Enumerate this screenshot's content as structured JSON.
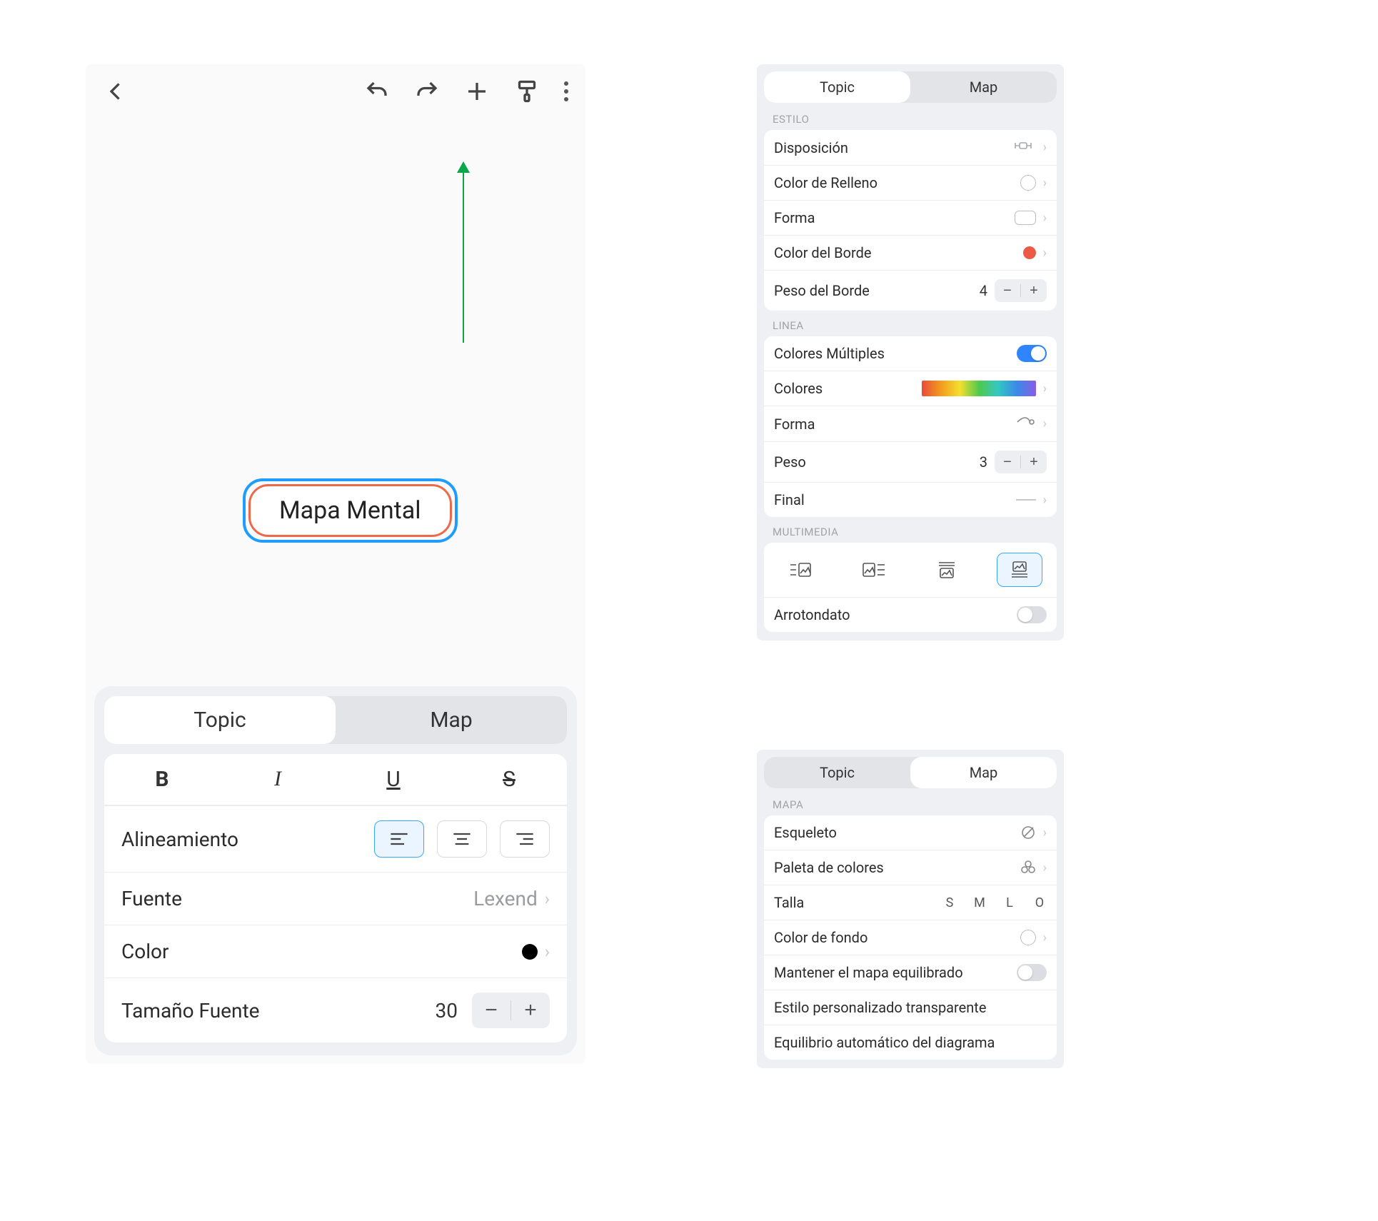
{
  "left_panel": {
    "canvas_node_text": "Mapa Mental",
    "tabs": {
      "topic": "Topic",
      "map": "Map"
    },
    "rows": {
      "alignment_label": "Alineamiento",
      "font_label": "Fuente",
      "font_value": "Lexend",
      "color_label": "Color",
      "font_size_label": "Tamaño Fuente",
      "font_size_value": "30"
    }
  },
  "right_top": {
    "tabs": {
      "topic": "Topic",
      "map": "Map"
    },
    "sections": {
      "estilo": "ESTILO",
      "linea": "LINEA",
      "multimedia": "MULTIMEDIA"
    },
    "estilo": {
      "disposicion": "Disposición",
      "relleno": "Color de Relleno",
      "forma": "Forma",
      "borde_color": "Color del Borde",
      "borde_peso": "Peso del Borde",
      "borde_peso_value": "4"
    },
    "linea": {
      "multiples": "Colores Múltiples",
      "colores": "Colores",
      "forma": "Forma",
      "peso": "Peso",
      "peso_value": "3",
      "final": "Final"
    },
    "multimedia": {
      "arrotondato": "Arrotondato"
    }
  },
  "right_bottom": {
    "tabs": {
      "topic": "Topic",
      "map": "Map"
    },
    "section": "MAPA",
    "rows": {
      "esqueleto": "Esqueleto",
      "paleta": "Paleta de colores",
      "talla": "Talla",
      "talla_opts": [
        "S",
        "M",
        "L",
        "O"
      ],
      "fondo": "Color de fondo",
      "equilibrado": "Mantener el mapa equilibrado",
      "transparente": "Estilo personalizado transparente",
      "auto": "Equilibrio automático del diagrama"
    }
  }
}
